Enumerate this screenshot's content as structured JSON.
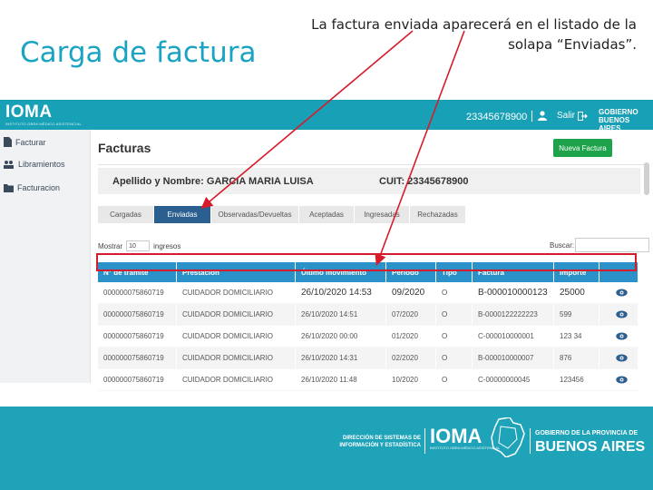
{
  "slide": {
    "title": "Carga de factura",
    "caption": "La factura enviada aparecerá en el listado de la solapa “Enviadas”."
  },
  "topbar": {
    "logo": "IOMA",
    "logo_sub": "INSTITUTO OBRA MÉDICO ASISTENCIAL",
    "user_id": "23345678900",
    "logout_label": "Salir",
    "province_logo_line1": "GOBIERNO",
    "province_logo_line2": "BUENOS AIRES",
    "bar_color": "#17a0b6"
  },
  "sidebar": {
    "items": [
      {
        "label": "Facturar",
        "icon": "document-icon"
      },
      {
        "label": "Libramientos",
        "icon": "group-icon"
      },
      {
        "label": "Facturacion",
        "icon": "folder-icon"
      }
    ]
  },
  "main": {
    "heading": "Facturas",
    "new_button": "Nueva Factura",
    "name_label": "Apellido y Nombre:",
    "name_value": "GARCIA MARIA LUISA",
    "cuit_label": "CUIT:",
    "cuit_value": "23345678900",
    "tabs": [
      {
        "label": "Cargadas",
        "active": false
      },
      {
        "label": "Enviadas",
        "active": true
      },
      {
        "label": "Observadas/Devueltas",
        "active": false
      },
      {
        "label": "Aceptadas",
        "active": false
      },
      {
        "label": "Ingresadas",
        "active": false
      },
      {
        "label": "Rechazadas",
        "active": false
      }
    ],
    "mostrar_label": "Mostrar",
    "mostrar_value": "10",
    "ingresos_label": "ingresos",
    "buscar_label": "Buscar:",
    "buscar_value": "",
    "accent_green": "#1ea24a",
    "table_header_color": "#2b92c9",
    "highlight_color": "#d61c2a"
  },
  "table": {
    "columns": [
      "N° de trámite",
      "Prestación",
      "Último movimiento",
      "Periodo",
      "Tipo",
      "Factura",
      "Importe",
      ""
    ],
    "rows": [
      [
        "000000075860719",
        "CUIDADOR DOMICILIARIO",
        "26/10/2020 14:53",
        "09/2020",
        "O",
        "B-000010000123",
        "25000"
      ],
      [
        "000000075860719",
        "CUIDADOR DOMICILIARIO",
        "26/10/2020 14:51",
        "07/2020",
        "O",
        "B-0000122222223",
        "599"
      ],
      [
        "000000075860719",
        "CUIDADOR DOMICILIARIO",
        "26/10/2020 00:00",
        "01/2020",
        "O",
        "C-000010000001",
        "123 34"
      ],
      [
        "000000075860719",
        "CUIDADOR DOMICILIARIO",
        "26/10/2020 14:31",
        "02/2020",
        "O",
        "B-000010000007",
        "876"
      ],
      [
        "000000075860719",
        "CUIDADOR DOMICILIARIO",
        "26/10/2020 11:48",
        "10/2020",
        "O",
        "C-00000000045",
        "123456"
      ]
    ]
  },
  "footer": {
    "dir_line1": "DIRECCIÓN DE SISTEMAS DE",
    "dir_line2": "INFORMACIÓN Y ESTADÍSTICA",
    "ioma": "IOMA",
    "ioma_sub": "INSTITUTO OBRA MÉDICO ASISTENCIAL",
    "gob": "GOBIERNO DE LA PROVINCIA DE",
    "ba": "BUENOS AIRES",
    "bg_color": "#1ea3b8"
  }
}
